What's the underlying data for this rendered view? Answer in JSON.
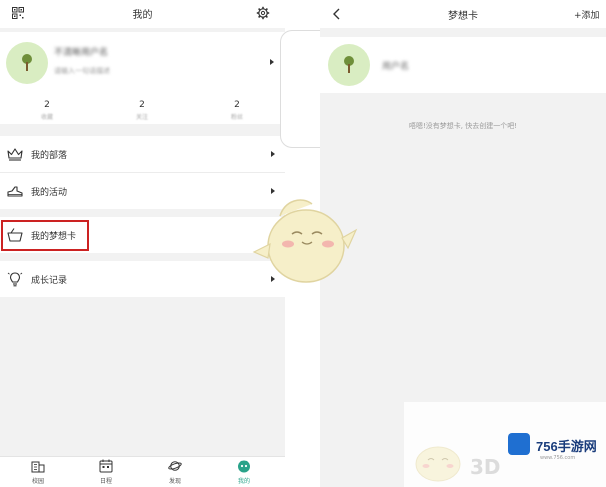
{
  "left": {
    "header": {
      "title": "我的"
    },
    "profile": {
      "name": "不清晰用户名",
      "signature": "请输入一句话描述",
      "stats": [
        {
          "value": "2",
          "label": "收藏"
        },
        {
          "value": "2",
          "label": "关注"
        },
        {
          "value": "2",
          "label": "粉丝"
        }
      ]
    },
    "menu": {
      "tribe": "我的部落",
      "activity": "我的活动",
      "dream_card": "我的梦想卡",
      "growth": "成长记录"
    },
    "tabs": [
      {
        "label": "校园"
      },
      {
        "label": "日程"
      },
      {
        "label": "发现"
      },
      {
        "label": "我的",
        "active": true
      }
    ]
  },
  "right": {
    "header": {
      "title": "梦想卡",
      "add_label": "+添加"
    },
    "card": {
      "name": "用户名"
    },
    "empty_text": "唔嗯!没有梦想卡, 快去创建一个吧!"
  },
  "watermark": {
    "brand": "756手游网",
    "url": "www.756.com",
    "overlay": "3D"
  },
  "colors": {
    "accent": "#2aa38a",
    "highlight": "#cc2222",
    "avatar_bg": "#d9edc2",
    "background": "#f2f2f2"
  },
  "icons": [
    "qr-code-icon",
    "gear-icon",
    "crown-icon",
    "shoe-icon",
    "basket-icon",
    "lightbulb-icon",
    "building-icon",
    "calendar-icon",
    "planet-icon",
    "mascot-icon",
    "back-arrow-icon"
  ]
}
